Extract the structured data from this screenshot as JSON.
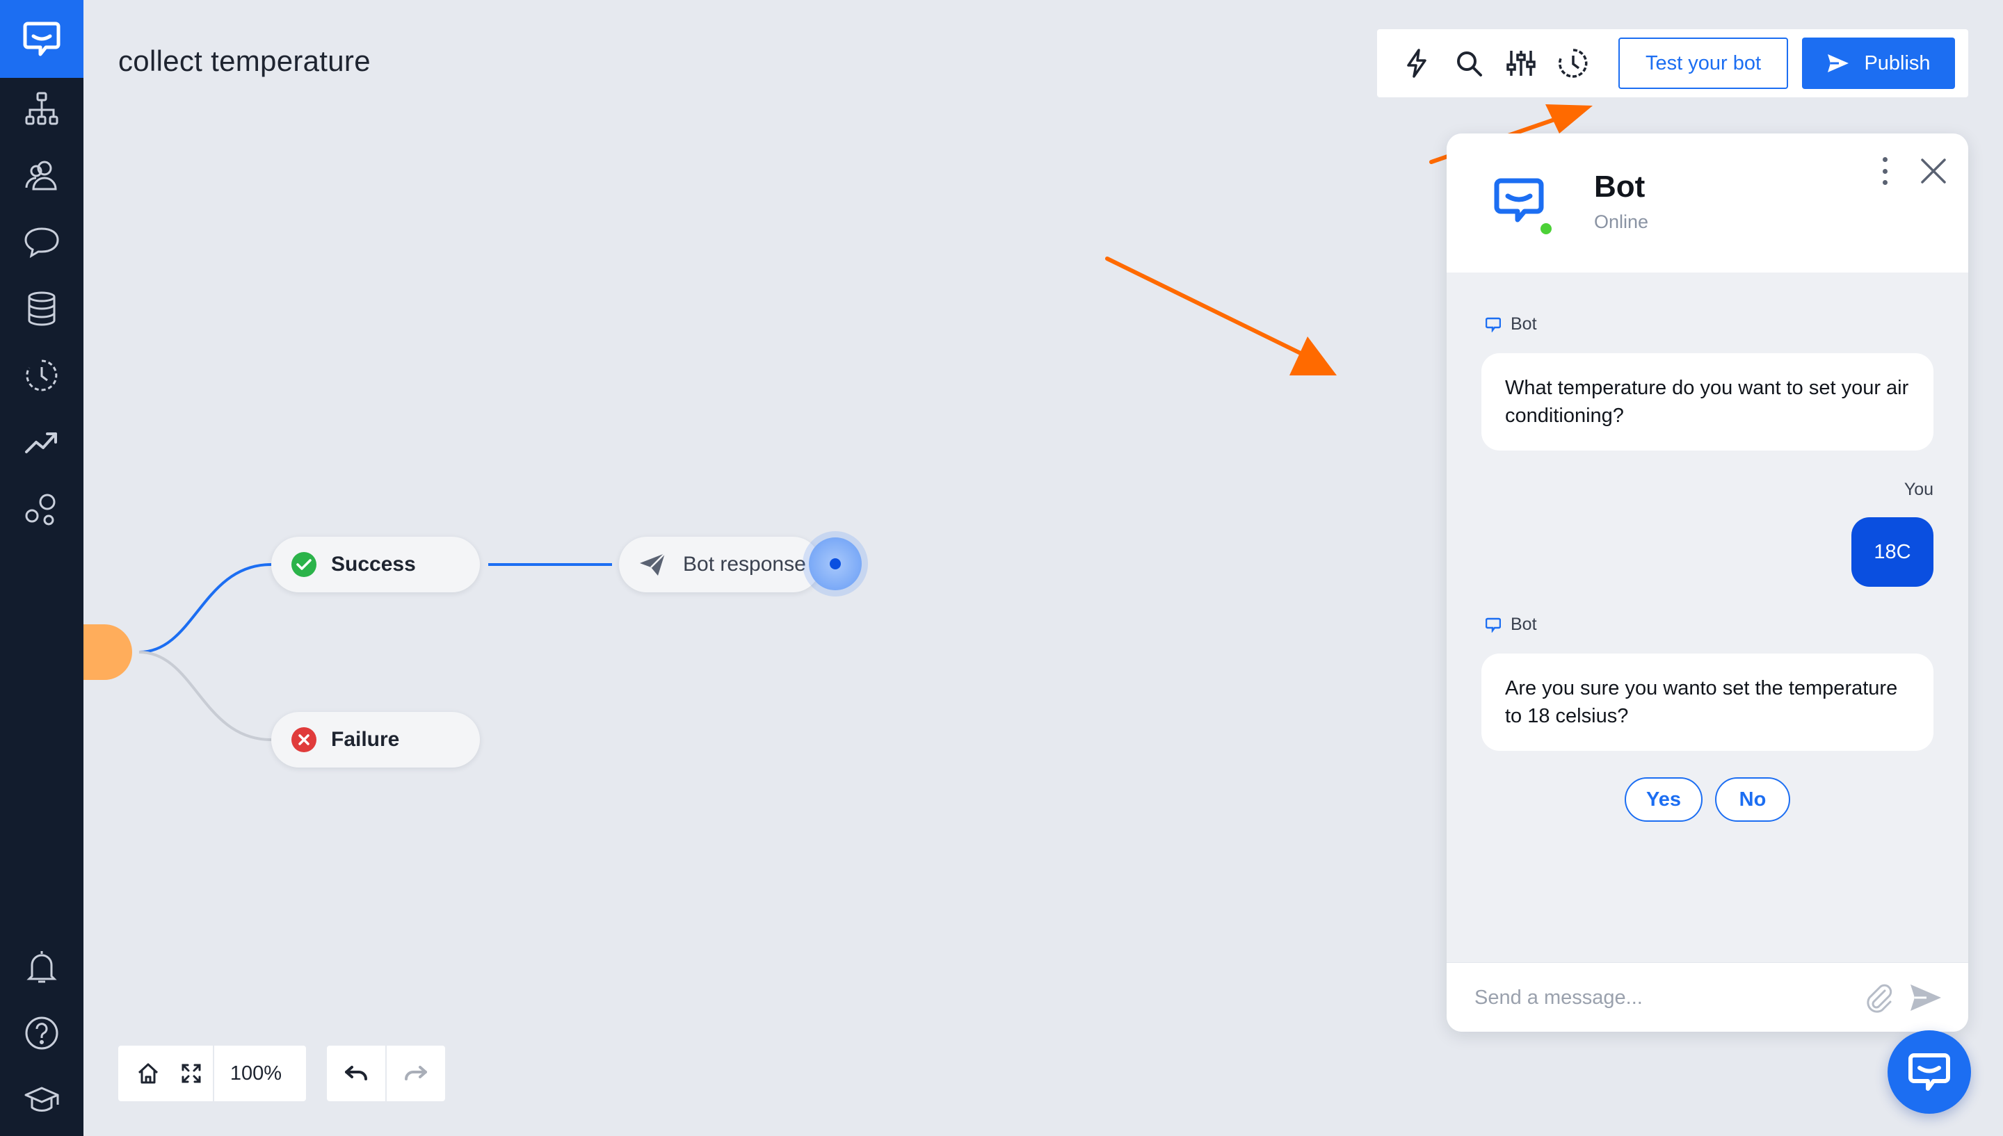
{
  "page": {
    "title": "collect temperature"
  },
  "sidebar": {
    "logo": "livechat-logo-icon",
    "items": [
      {
        "icon": "flow-tree-icon"
      },
      {
        "icon": "users-icon"
      },
      {
        "icon": "chat-bubble-icon"
      },
      {
        "icon": "database-icon"
      },
      {
        "icon": "history-icon"
      },
      {
        "icon": "reports-icon"
      },
      {
        "icon": "integrations-icon"
      }
    ],
    "bottom_items": [
      {
        "icon": "bell-icon"
      },
      {
        "icon": "help-icon"
      },
      {
        "icon": "academy-icon"
      }
    ]
  },
  "toolbar": {
    "icons": [
      "lightning-icon",
      "search-icon",
      "settings-sliders-icon",
      "history-icon"
    ],
    "test_label": "Test your bot",
    "publish_label": "Publish"
  },
  "flow": {
    "success_label": "Success",
    "failure_label": "Failure",
    "bot_response_label": "Bot response"
  },
  "canvas_controls": {
    "zoom": "100%"
  },
  "chat": {
    "name": "Bot",
    "status": "Online",
    "messages": [
      {
        "sender": "Bot",
        "text": "What temperature do you want to set your air conditioning?"
      },
      {
        "sender": "You",
        "text": "18C"
      },
      {
        "sender": "Bot",
        "text": "Are you sure you wanto set the temperature to 18 celsius?"
      }
    ],
    "quick_replies": [
      "Yes",
      "No"
    ],
    "input_placeholder": "Send a message..."
  },
  "colors": {
    "accent": "#1c6ef2",
    "sidebar": "#121c2d",
    "canvas": "#e6e9ef",
    "arrow": "#ff6a00",
    "success": "#2bb34a",
    "failure": "#e03b3b",
    "trigger_node": "#ffad5b"
  }
}
